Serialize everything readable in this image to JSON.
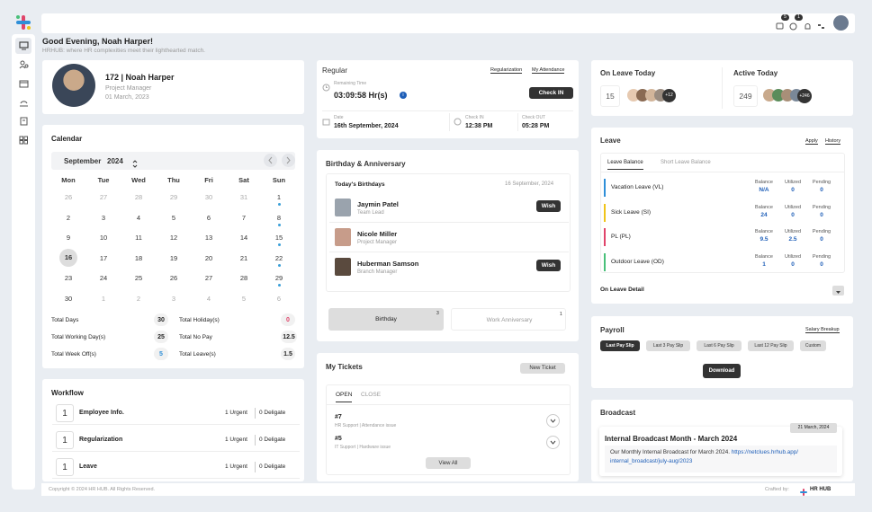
{
  "user": {
    "greeting": "Good Evening, Noah Harper!",
    "subtitle": "HRHUB: where HR complexities meet their lighthearted match.",
    "id_name": "172 | Noah Harper",
    "role": "Project Manager",
    "joined": "01 March, 2023"
  },
  "topbar": {
    "badge1": "5",
    "badge2": "1"
  },
  "calendar": {
    "title": "Calendar",
    "month": "September",
    "year": "2024",
    "weekdays": [
      "Mon",
      "Tue",
      "Wed",
      "Thu",
      "Fri",
      "Sat",
      "Sun"
    ],
    "weeks": [
      [
        "26",
        "27",
        "28",
        "29",
        "30",
        "31",
        "1"
      ],
      [
        "2",
        "3",
        "4",
        "5",
        "6",
        "7",
        "8"
      ],
      [
        "9",
        "10",
        "11",
        "12",
        "13",
        "14",
        "15"
      ],
      [
        "16",
        "17",
        "18",
        "19",
        "20",
        "21",
        "22"
      ],
      [
        "23",
        "24",
        "25",
        "26",
        "27",
        "28",
        "29"
      ],
      [
        "30",
        "1",
        "2",
        "3",
        "4",
        "5",
        "6"
      ]
    ],
    "stats": {
      "total_days_label": "Total Days",
      "total_days": "30",
      "total_holidays_label": "Total Holiday(s)",
      "total_holidays": "0",
      "working_days_label": "Total Working Day(s)",
      "working_days": "25",
      "no_pay_label": "Total No Pay",
      "no_pay": "12.5",
      "week_off_label": "Total Week Off(s)",
      "week_off": "5",
      "leaves_label": "Total Leave(s)",
      "leaves": "1.5"
    }
  },
  "workflow": {
    "title": "Workflow",
    "items": [
      {
        "num": "1",
        "label": "Employee Info.",
        "urgent": "1 Urgent",
        "deligate": "0 Deligate"
      },
      {
        "num": "1",
        "label": "Regularization",
        "urgent": "1 Urgent",
        "deligate": "0 Deligate"
      },
      {
        "num": "1",
        "label": "Leave",
        "urgent": "1 Urgent",
        "deligate": "0 Deligate"
      }
    ]
  },
  "attendance": {
    "title": "Regular",
    "link1": "Regularization",
    "link2": "My Attendance",
    "remaining_label": "Remaining Time",
    "remaining": "03:09:58 Hr(s)",
    "checkin_btn": "Check IN",
    "date_label": "Date",
    "date": "16th September, 2024",
    "checkin_label": "Check IN",
    "checkin": "12:38 PM",
    "checkout_label": "Check OUT",
    "checkout": "05:28 PM"
  },
  "birthday": {
    "title": "Birthday & Anniversary",
    "today_label": "Today's Birthdays",
    "today_date": "16 September, 2024",
    "people": [
      {
        "name": "Jaymin Patel",
        "role": "Team Lead",
        "action": "Wish"
      },
      {
        "name": "Nicole Miller",
        "role": "Project Manager",
        "action": ""
      },
      {
        "name": "Huberman Samson",
        "role": "Branch Manager",
        "action": "Wish"
      }
    ],
    "tab1": "Birthday",
    "tab1_count": "3",
    "tab2": "Work Anniversary",
    "tab2_count": "1"
  },
  "tickets": {
    "title": "My Tickets",
    "new_btn": "New Ticket",
    "tab_open": "OPEN",
    "tab_close": "CLOSE",
    "items": [
      {
        "id": "#7",
        "desc": "HR Support | Attendance issue"
      },
      {
        "id": "#5",
        "desc": "IT Support | Hardware issue"
      }
    ],
    "view_all": "View All"
  },
  "onleave": {
    "title": "On Leave Today",
    "count": "15",
    "more": "+12"
  },
  "active": {
    "title": "Active Today",
    "count": "249",
    "more": "+246"
  },
  "leave": {
    "title": "Leave",
    "apply": "Apply",
    "history": "History",
    "tab1": "Leave Balance",
    "tab2": "Short Leave Balance",
    "col_balance": "Balance",
    "col_utilized": "Utilized",
    "col_pending": "Pending",
    "rows": [
      {
        "name": "Vacation Leave (VL)",
        "balance": "N/A",
        "utilized": "0",
        "pending": "0",
        "color": "#2f8fd8"
      },
      {
        "name": "Sick Leave (SI)",
        "balance": "24",
        "utilized": "0",
        "pending": "0",
        "color": "#f0c419"
      },
      {
        "name": "PL (PL)",
        "balance": "9.5",
        "utilized": "2.5",
        "pending": "0",
        "color": "#e0446a"
      },
      {
        "name": "Outdoor Leave (OD)",
        "balance": "1",
        "utilized": "0",
        "pending": "0",
        "color": "#49c07a"
      }
    ],
    "detail": "On Leave Detail"
  },
  "payroll": {
    "title": "Payroll",
    "breakup": "Salary Breakup",
    "options": [
      "Last Pay Slip",
      "Last 3 Pay Slip",
      "Last 6 Pay Slip",
      "Last 12 Pay Slip",
      "Custom"
    ],
    "download": "Download"
  },
  "broadcast": {
    "title": "Broadcast",
    "date": "21 March, 2024",
    "headline": "Internal Broadcast Month - March 2024",
    "body": "Our Monthly Internal Broadcast for March 2024.",
    "link": "https://netclues.hrhub.app/internal_broadcast/july-aug/2023",
    "link_a": "https://netclues.hrhub.app/",
    "link_b": "internal_broadcast/july-aug/2023"
  },
  "footer": {
    "copyright": "Copyright © 2024 HR HUB. All Rights Reserved.",
    "crafted": "Crafted by:",
    "brand": "HR HUB"
  }
}
